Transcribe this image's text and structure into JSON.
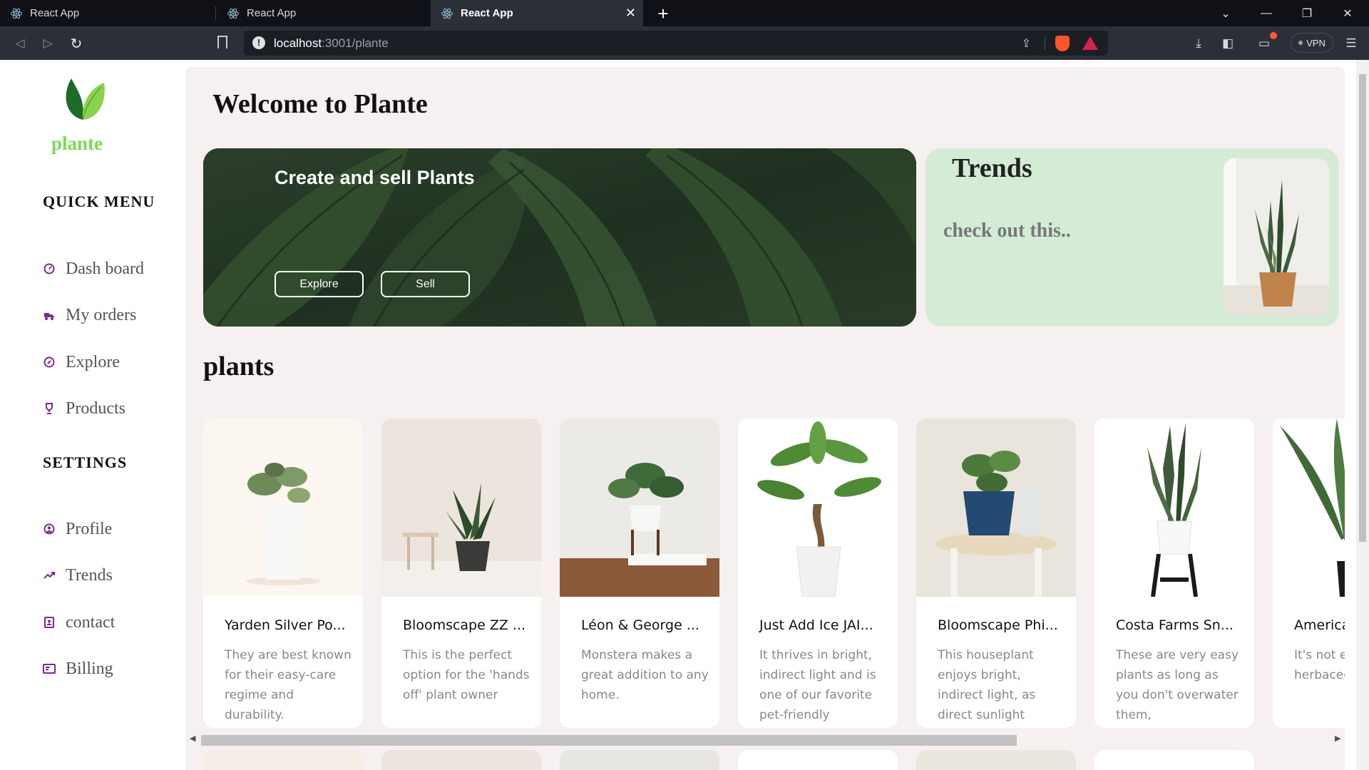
{
  "browser": {
    "tabs": [
      {
        "title": "React App",
        "active": false
      },
      {
        "title": "React App",
        "active": false
      },
      {
        "title": "React App",
        "active": true
      }
    ],
    "address": {
      "host": "localhost",
      "path": ":3001/plante"
    },
    "vpn_label": "VPN"
  },
  "sidebar": {
    "brand": "plante",
    "quick_menu_heading": "QUICK MENU",
    "quick_menu": [
      {
        "label": "Dash board",
        "icon": "dashboard-icon"
      },
      {
        "label": "My orders",
        "icon": "orders-icon"
      },
      {
        "label": "Explore",
        "icon": "compass-icon"
      },
      {
        "label": "Products",
        "icon": "trophy-icon"
      }
    ],
    "settings_heading": "SETTINGS",
    "settings": [
      {
        "label": "Profile",
        "icon": "profile-icon"
      },
      {
        "label": "Trends",
        "icon": "trend-icon"
      },
      {
        "label": "contact",
        "icon": "contact-icon"
      },
      {
        "label": "Billing",
        "icon": "billing-icon"
      }
    ],
    "accent_color": "#7ed957",
    "icon_color": "#7a2b8c"
  },
  "main": {
    "welcome": "Welcome to Plante",
    "hero": {
      "title": "Create and sell Plants",
      "explore_label": "Explore",
      "sell_label": "Sell"
    },
    "trends": {
      "title": "Trends",
      "subtitle": "check out this.."
    },
    "plants_heading": "plants",
    "plants": [
      {
        "name": "Yarden Silver Po...",
        "desc": "They are best known for their easy-care regime and durability."
      },
      {
        "name": "Bloomscape ZZ ...",
        "desc": "This is the perfect option for the 'hands off' plant owner"
      },
      {
        "name": "Léon & George ...",
        "desc": "Monstera makes a great addition to any home."
      },
      {
        "name": "Just Add Ice JAI...",
        "desc": "It thrives in bright, indirect light and is one of our favorite pet-friendly"
      },
      {
        "name": "Bloomscape Phi...",
        "desc": "This houseplant enjoys bright, indirect light, as direct sunlight"
      },
      {
        "name": "Costa Farms Sn...",
        "desc": "These are very easy plants as long as you don't overwater them,"
      },
      {
        "name": "America",
        "desc": "It's not e the hardy herbaceo perennia"
      }
    ]
  }
}
